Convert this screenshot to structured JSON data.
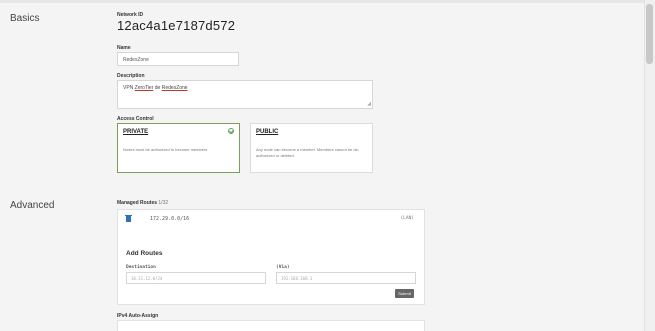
{
  "sections": {
    "basics": "Basics",
    "advanced": "Advanced"
  },
  "network": {
    "id_label": "Network ID",
    "id_value": "12ac4a1e7187d572"
  },
  "name": {
    "label": "Name",
    "value": "RedesZone"
  },
  "description": {
    "label": "Description",
    "value_prefix": "VPN ",
    "value_word1": "ZeroTier",
    "value_mid": " de ",
    "value_word2": "RedesZone"
  },
  "access_control": {
    "label": "Access Control",
    "private": {
      "title": "PRIVATE",
      "desc": "Nodes must be authorized to become members"
    },
    "public": {
      "title": "PUBLIC",
      "desc": "Any node can become a member. Members cannot be de-authorized or deleted."
    }
  },
  "managed_routes": {
    "label": "Managed Routes",
    "count": "1/32",
    "routes": [
      {
        "target": "172.29.0.0/16",
        "via": "(LAN)"
      }
    ],
    "add_routes_title": "Add Routes",
    "destination_label": "Destination",
    "destination_placeholder": "10.11.12.0/24",
    "via_label": "(Via)",
    "via_placeholder": "192.168.168.1",
    "submit_label": "Submit"
  },
  "ipv4": {
    "label": "IPv4 Auto-Assign"
  }
}
